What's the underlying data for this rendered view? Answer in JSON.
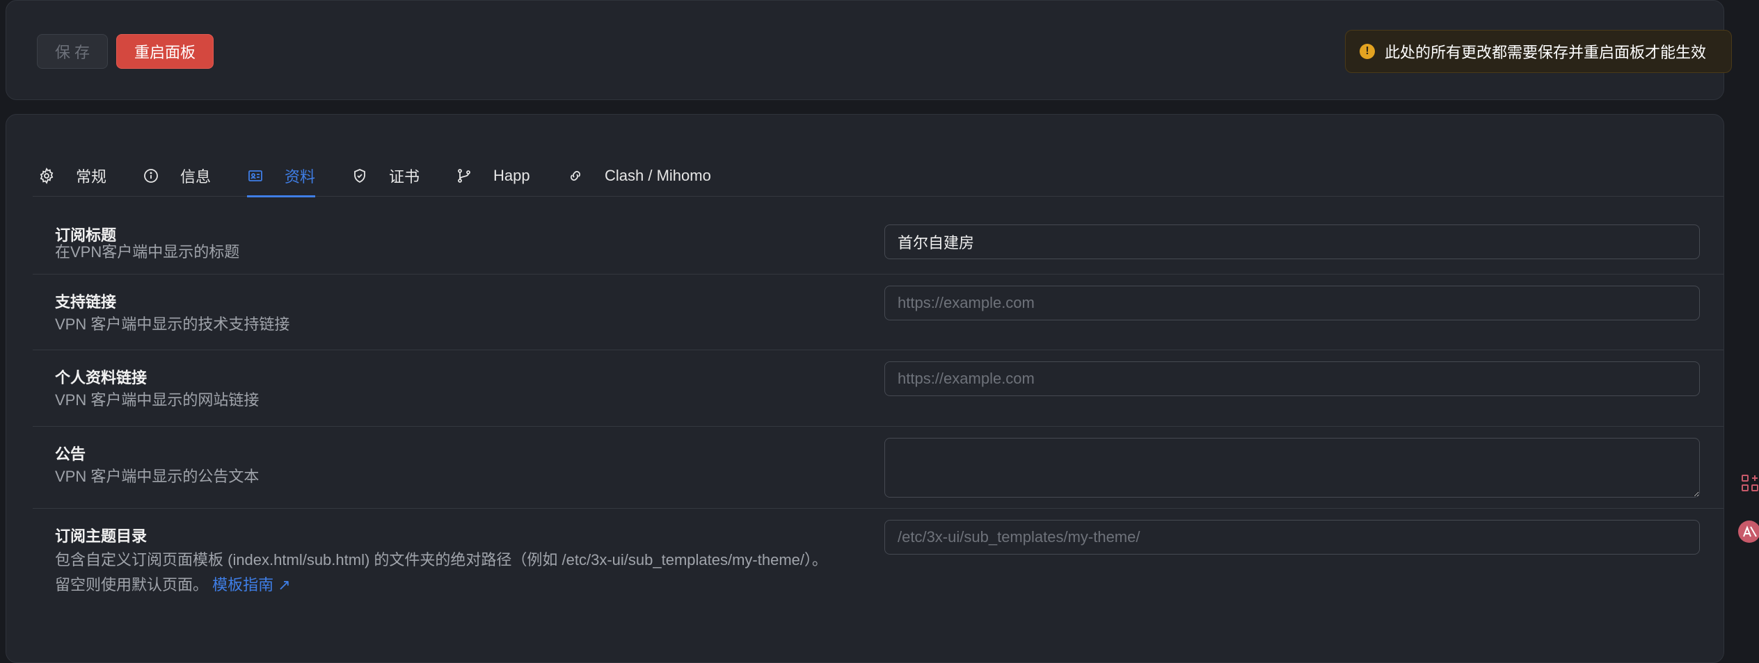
{
  "toolbar": {
    "save_label": "保存",
    "restart_label": "重启面板",
    "notice_icon": "!",
    "notice_text": "此处的所有更改都需要保存并重启面板才能生效"
  },
  "tabs": [
    {
      "label": "常规",
      "icon": "gear-icon"
    },
    {
      "label": "信息",
      "icon": "info-icon"
    },
    {
      "label": "资料",
      "icon": "id-card-icon"
    },
    {
      "label": "证书",
      "icon": "shield-icon"
    },
    {
      "label": "Happ",
      "icon": "branch-icon"
    },
    {
      "label": "Clash / Mihomo",
      "icon": "link-icon"
    }
  ],
  "active_tab": "资料",
  "accent_color": "#3f7ee6",
  "danger_color": "#d4483f",
  "fields": [
    {
      "title": "订阅标题",
      "description": "在VPN客户端中显示的标题",
      "value": "首尔自建房",
      "placeholder": ""
    },
    {
      "title": "支持链接",
      "description": "VPN 客户端中显示的技术支持链接",
      "value": "",
      "placeholder": "https://example.com"
    },
    {
      "title": "个人资料链接",
      "description": "VPN 客户端中显示的网站链接",
      "value": "",
      "placeholder": "https://example.com"
    },
    {
      "title": "公告",
      "description": "VPN 客户端中显示的公告文本",
      "value": "",
      "placeholder": ""
    },
    {
      "title": "订阅主题目录",
      "description_line1": "包含自定义订阅页面模板 (index.html/sub.html) 的文件夹的绝对路径（例如 /etc/3x-ui/sub_templates/my-theme/）。",
      "description_line2": "留空则使用默认页面。",
      "link_label": "模板指南 ↗",
      "value": "",
      "placeholder": "/etc/3x-ui/sub_templates/my-theme/"
    }
  ]
}
